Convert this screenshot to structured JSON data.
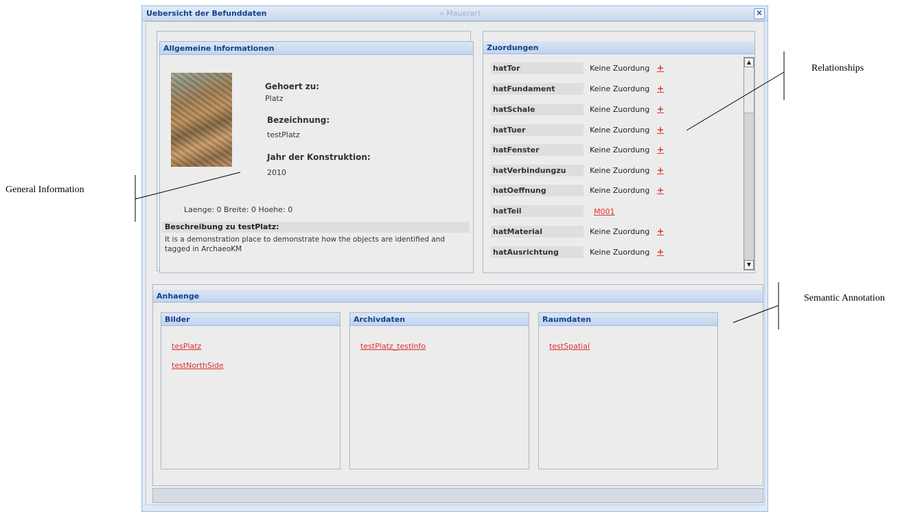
{
  "window": {
    "title": "Uebersicht der Befunddaten",
    "ghost_tab": "» Mauerart",
    "close_icon": "close-icon"
  },
  "general": {
    "header": "Allgemeine Informationen",
    "photo_icon": "site-photo",
    "gehoert_label": "Gehoert zu:",
    "gehoert_value": "Platz",
    "bezeichnung_label": "Bezeichnung:",
    "bezeichnung_value": "testPlatz",
    "jahr_label": "Jahr der Konstruktion:",
    "jahr_value": "2010",
    "dimensions": "Laenge: 0 Breite: 0 Hoehe: 0",
    "description_label": "Beschreibung zu testPlatz:",
    "description_line1": "It is a demonstration place to demonstrate how the objects are identified and",
    "description_line2": "tagged in ArchaeoKM"
  },
  "relations": {
    "header": "Zuordungen",
    "plus": "+",
    "items": [
      {
        "name": "hatTor",
        "status": "Keine Zuordung"
      },
      {
        "name": "hatFundament",
        "status": "Keine Zuordung"
      },
      {
        "name": "hatSchale",
        "status": "Keine Zuordung"
      },
      {
        "name": "hatTuer",
        "status": "Keine Zuordung"
      },
      {
        "name": "hatFenster",
        "status": "Keine Zuordung"
      },
      {
        "name": "hatVerbindungzu",
        "status": "Keine Zuordung"
      },
      {
        "name": "hatOeffnung",
        "status": "Keine Zuordung"
      },
      {
        "name": "hatTeil",
        "link": "M001"
      },
      {
        "name": "hatMaterial",
        "status": "Keine Zuordung"
      },
      {
        "name": "hatAusrichtung",
        "status": "Keine Zuordung"
      }
    ]
  },
  "attachments": {
    "header": "Anhaenge",
    "bilder": {
      "header": "Bilder",
      "items": [
        "tesPlatz",
        "testNorthSide"
      ]
    },
    "archiv": {
      "header": "Archivdaten",
      "items": [
        "testPlatz_testInfo"
      ]
    },
    "raum": {
      "header": "Raumdaten",
      "items": [
        "testSpatial"
      ]
    }
  },
  "annotations": {
    "general": "General Information",
    "relationships": "Relationships",
    "semantic": "Semantic Annotation"
  },
  "colors": {
    "link_red": "#e03030",
    "header_blue": "#15428b",
    "border_blue": "#99bbe8"
  }
}
